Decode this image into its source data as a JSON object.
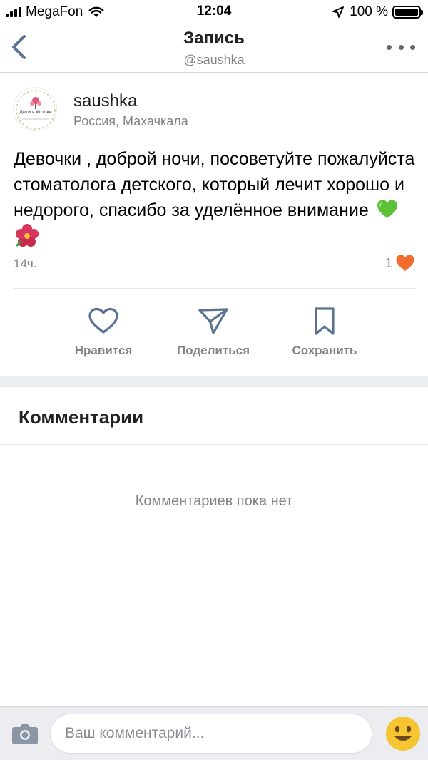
{
  "status_bar": {
    "carrier": "MegaFon",
    "time": "12:04",
    "battery": "100 %"
  },
  "nav": {
    "title": "Запись",
    "subtitle": "@saushka"
  },
  "post": {
    "author": "saushka",
    "location": "Россия, Махачкала",
    "text": "Девочки , доброй ночи, посоветуйте пожалуйста стоматолога детского, который лечит хорошо и недорого, спасибо за уделённое внимание",
    "time": "14ч.",
    "likes": "1",
    "avatar_text": "Дети в Истоке"
  },
  "actions": {
    "like": "Нравится",
    "share": "Поделиться",
    "save": "Сохранить"
  },
  "comments": {
    "title": "Комментарии",
    "empty": "Комментариев пока нет"
  },
  "composer": {
    "placeholder": "Ваш комментарий..."
  },
  "colors": {
    "accent": "#5a7390",
    "like_orange": "#f26c2f",
    "muted": "#828282"
  }
}
